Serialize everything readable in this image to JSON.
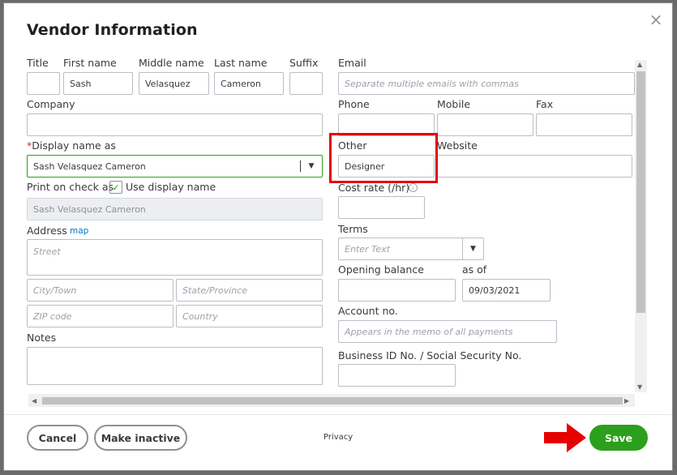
{
  "dialog": {
    "title": "Vendor Information",
    "close_glyph": "×"
  },
  "name_fields": {
    "title_label": "Title",
    "title_value": "",
    "first_label": "First name",
    "first_value": "Sash",
    "middle_label": "Middle name",
    "middle_value": "Velasquez",
    "last_label": "Last name",
    "last_value": "Cameron",
    "suffix_label": "Suffix",
    "suffix_value": ""
  },
  "company": {
    "label": "Company",
    "value": ""
  },
  "display_name": {
    "required_mark": "*",
    "label": "Display name as",
    "value": "Sash Velasquez Cameron",
    "arrow": "▼"
  },
  "print_on_check": {
    "label": "Print on check as",
    "checked_glyph": "✓",
    "checkbox_label": "Use display name",
    "value": "Sash Velasquez Cameron"
  },
  "address": {
    "label": "Address",
    "map_link": "map",
    "street_placeholder": "Street",
    "city_placeholder": "City/Town",
    "state_placeholder": "State/Province",
    "zip_placeholder": "ZIP code",
    "country_placeholder": "Country"
  },
  "notes": {
    "label": "Notes",
    "value": ""
  },
  "email": {
    "label": "Email",
    "placeholder": "Separate multiple emails with commas"
  },
  "phone": {
    "label": "Phone",
    "value": ""
  },
  "mobile": {
    "label": "Mobile",
    "value": ""
  },
  "fax": {
    "label": "Fax",
    "value": ""
  },
  "other": {
    "label": "Other",
    "value": "Designer"
  },
  "website": {
    "label": "Website",
    "value": ""
  },
  "cost_rate": {
    "label": "Cost rate (/hr)",
    "info_glyph": "i",
    "value": ""
  },
  "terms": {
    "label": "Terms",
    "placeholder": "Enter Text",
    "arrow": "▼"
  },
  "opening_balance": {
    "label": "Opening balance",
    "value": ""
  },
  "as_of": {
    "label": "as of",
    "value": "09/03/2021"
  },
  "account_no": {
    "label": "Account no.",
    "placeholder": "Appears in the memo of all payments"
  },
  "business_id": {
    "label": "Business ID No. / Social Security No.",
    "value": ""
  },
  "scroll": {
    "up": "▲",
    "down": "▼",
    "left": "◀",
    "right": "▶"
  },
  "footer": {
    "cancel_label": "Cancel",
    "make_inactive_label": "Make inactive",
    "privacy_label": "Privacy",
    "save_label": "Save"
  },
  "colors": {
    "highlight": "#e60000",
    "save_green": "#2ca01c",
    "arrow_red": "#e60000"
  }
}
